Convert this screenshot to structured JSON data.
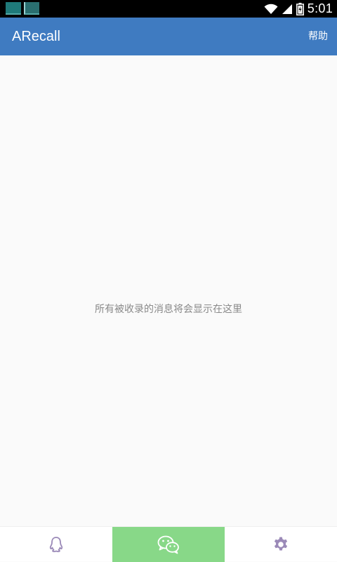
{
  "status_bar": {
    "time": "5:01",
    "wifi_icon": "wifi-icon",
    "signal_icon": "signal-icon",
    "battery_icon": "battery-icon"
  },
  "app_bar": {
    "title": "ARecall",
    "help_label": "帮助"
  },
  "content": {
    "empty_hint": "所有被收录的消息将会显示在这里"
  },
  "bottom_tabs": [
    {
      "icon": "qq-icon",
      "active": false
    },
    {
      "icon": "wechat-icon",
      "active": true
    },
    {
      "icon": "gear-icon",
      "active": false
    }
  ],
  "colors": {
    "app_bar": "#3f7bc1",
    "active_tab": "#88d888",
    "icon_tint": "#9b8ab8",
    "wechat_icon": "#ffffff"
  }
}
